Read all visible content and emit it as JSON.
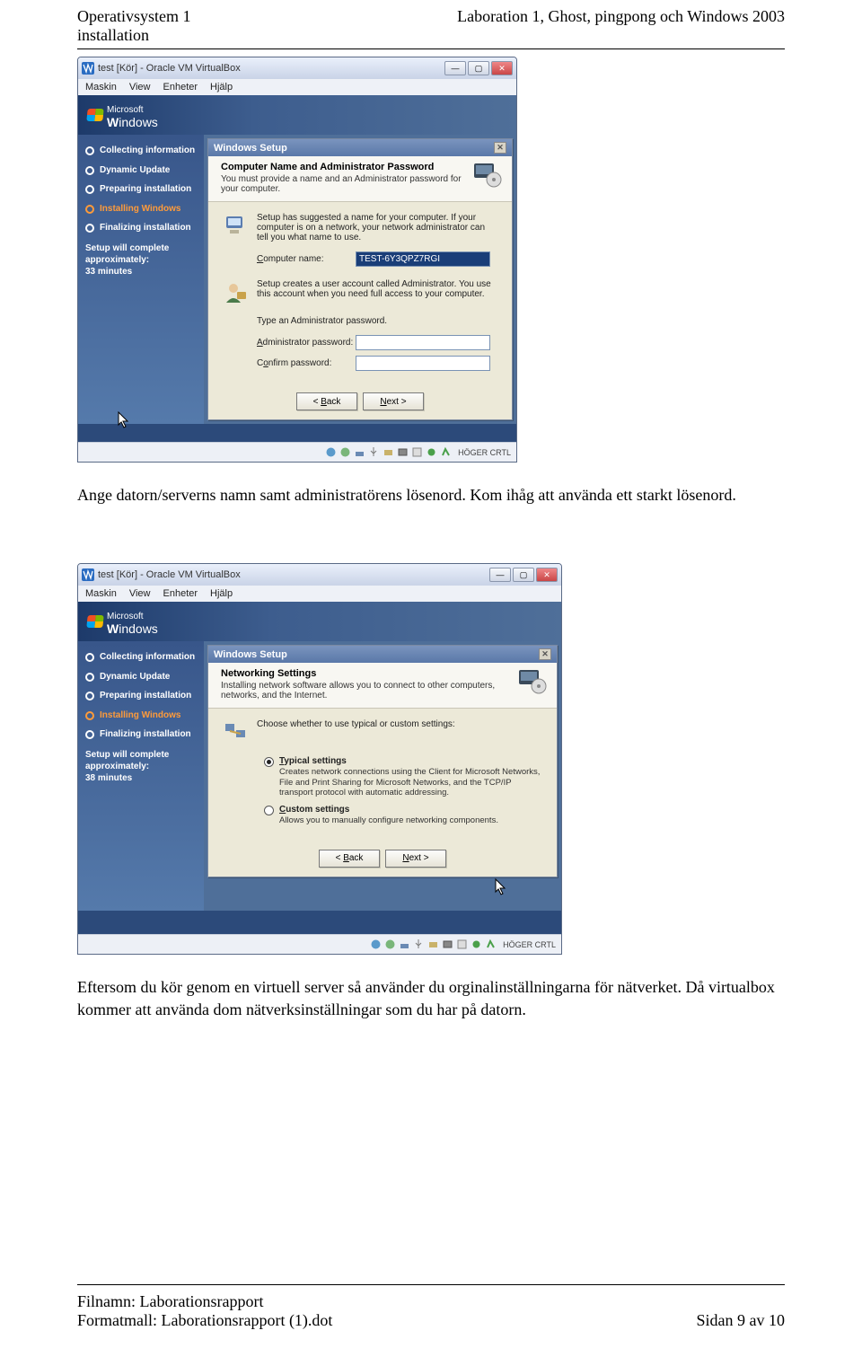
{
  "doc": {
    "header_left_1": "Operativsystem 1",
    "header_left_2": "installation",
    "header_right": "Laboration 1, Ghost, pingpong och Windows 2003",
    "para1": "Ange datorn/serverns namn samt administratörens lösenord. Kom ihåg att använda ett starkt lösenord.",
    "para2": "Eftersom du kör genom en virtuell server så använder du orginalinställningarna för nätverket. Då virtualbox kommer att använda dom nätverksinställningar som du har på datorn.",
    "footer_left_1": "Filnamn: Laborationsrapport",
    "footer_left_2": "Formatmall: Laborationsrapport (1).dot",
    "footer_right": "Sidan 9 av 10"
  },
  "vm": {
    "title": "test [Kör] - Oracle VM VirtualBox",
    "menu": [
      "Maskin",
      "View",
      "Enheter",
      "Hjälp"
    ],
    "brand_prefix": "W",
    "brand": "indows",
    "side": {
      "steps": [
        {
          "label": "Collecting information",
          "active": false,
          "bold": true
        },
        {
          "label": "Dynamic Update",
          "active": false,
          "bold": true
        },
        {
          "label": "Preparing installation",
          "active": false,
          "bold": true
        },
        {
          "label": "Installing Windows",
          "active": true,
          "bold": true
        },
        {
          "label": "Finalizing installation",
          "active": false,
          "bold": true
        }
      ],
      "eta1_label": "Setup will complete approximately:",
      "eta1_time": "33 minutes",
      "eta2_time": "38 minutes"
    },
    "dlg1": {
      "bar": "Windows Setup",
      "head_title": "Computer Name and Administrator Password",
      "head_sub": "You must provide a name and an Administrator password for your computer.",
      "p1": "Setup has suggested a name for your computer. If your computer is on a network, your network administrator can tell you what name to use.",
      "comp_label": "Computer name:",
      "comp_value": "TEST-6Y3QPZ7RGI",
      "p2": "Setup creates a user account called Administrator. You use this account when you need full access to your computer.",
      "p3": "Type an Administrator password.",
      "admin_label": "Administrator password:",
      "confirm_label": "Confirm password:",
      "back": "< Back",
      "next": "Next >"
    },
    "dlg2": {
      "bar": "Windows Setup",
      "head_title": "Networking Settings",
      "head_sub": "Installing network software allows you to connect to other computers, networks, and the Internet.",
      "prompt": "Choose whether to use typical or custom settings:",
      "typ_title": "Typical settings",
      "typ_desc": "Creates network connections using the Client for Microsoft Networks, File and Print Sharing for Microsoft Networks, and the TCP/IP transport protocol with automatic addressing.",
      "cus_title": "Custom settings",
      "cus_desc": "Allows you to manually configure networking components.",
      "back": "< Back",
      "next": "Next >"
    },
    "hostkey": "HÖGER CRTL"
  }
}
